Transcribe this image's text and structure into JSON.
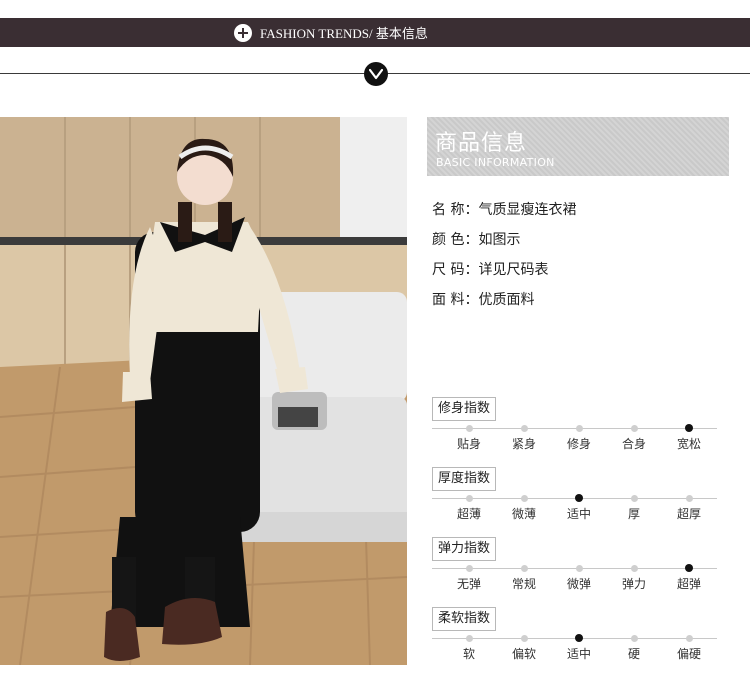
{
  "header": {
    "text": "FASHION TRENDS/  基本信息",
    "icon": "plus-circle-icon",
    "bg_color": "#3a2e33"
  },
  "divider": {
    "icon": "chevron-down-icon"
  },
  "banner": {
    "title": "商品信息",
    "subtitle": "BASIC INFORMATION"
  },
  "attributes": [
    {
      "text": "名 称：气质显瘦连衣裙"
    },
    {
      "text": "颜 色：如图示"
    },
    {
      "text": "尺 码：详见尺码表"
    },
    {
      "text": "面 料：优质面料"
    }
  ],
  "scales": [
    {
      "label": "修身指数",
      "options": [
        "贴身",
        "紧身",
        "修身",
        "合身",
        "宽松"
      ],
      "selected": 4
    },
    {
      "label": "厚度指数",
      "options": [
        "超薄",
        "微薄",
        "适中",
        "厚",
        "超厚"
      ],
      "selected": 2
    },
    {
      "label": "弹力指数",
      "options": [
        "无弹",
        "常规",
        "微弹",
        "弹力",
        "超弹"
      ],
      "selected": 4
    },
    {
      "label": "柔软指数",
      "options": [
        "软",
        "偏软",
        "适中",
        "硬",
        "偏硬"
      ],
      "selected": 2
    }
  ]
}
